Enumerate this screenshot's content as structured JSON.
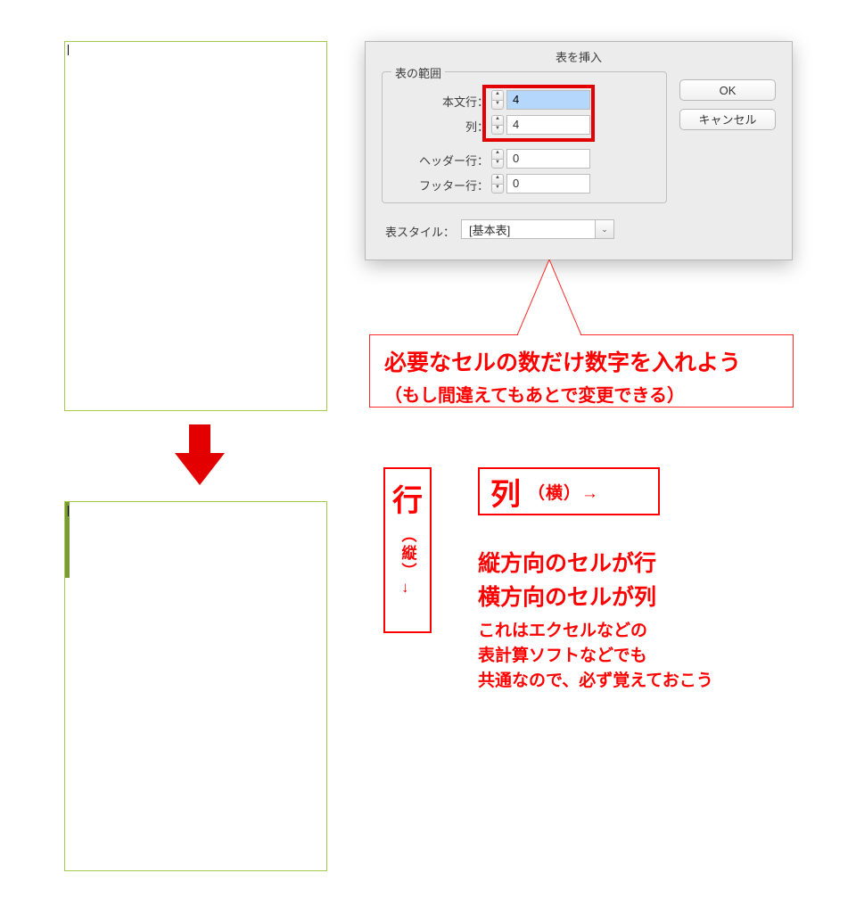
{
  "dialog": {
    "title": "表を挿入",
    "fieldset_legend": "表の範囲",
    "body_rows_label": "本文行：",
    "columns_label": "列：",
    "header_rows_label": "ヘッダー行：",
    "footer_rows_label": "フッター行：",
    "body_rows_value": "4",
    "columns_value": "4",
    "header_rows_value": "0",
    "footer_rows_value": "0",
    "style_label": "表スタイル：",
    "style_value": "[基本表]",
    "ok": "OK",
    "cancel": "キャンセル"
  },
  "callout": {
    "line1": "必要なセルの数だけ数字を入れよう",
    "line2": "（もし間違えてもあとで変更できる）"
  },
  "legend_boxes": {
    "gyou": "行",
    "gyou_sub": "（縦）→",
    "retsu": "列",
    "retsu_sub": "（横）→"
  },
  "explain": {
    "l1": "縦方向のセルが行",
    "l2": "横方向のセルが列",
    "l3": "これはエクセルなどの",
    "l4": "表計算ソフトなどでも",
    "l5": "共通なので、必ず覚えておこう"
  },
  "table": {
    "rows": 4,
    "cols": 4
  }
}
